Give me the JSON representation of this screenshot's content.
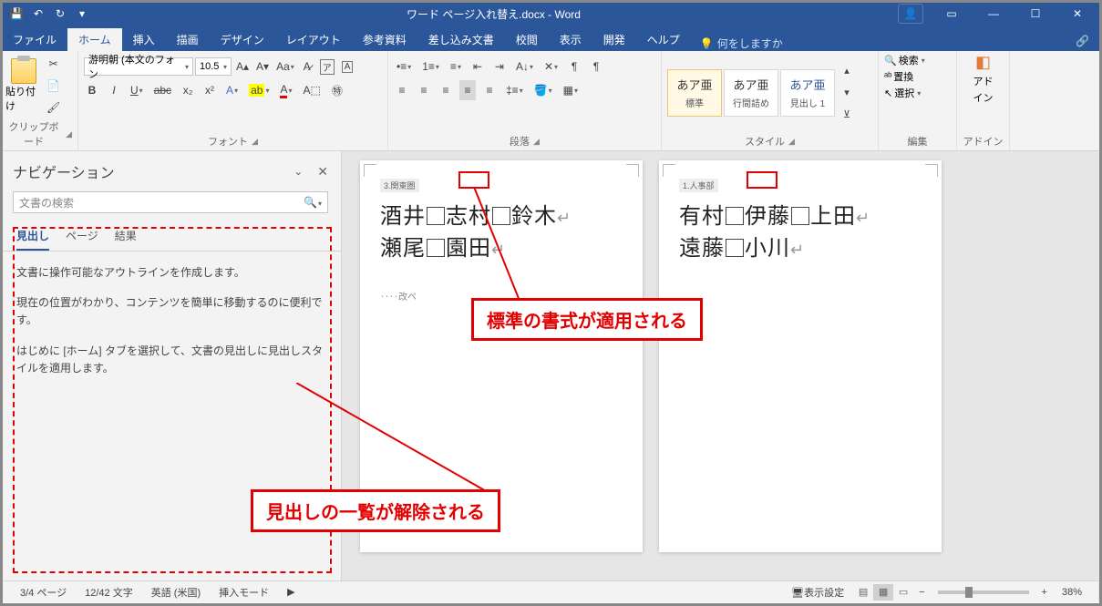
{
  "titlebar": {
    "title": "ワード ページ入れ替え.docx  -  Word"
  },
  "tabs": {
    "file": "ファイル",
    "home": "ホーム",
    "insert": "挿入",
    "draw": "描画",
    "design": "デザイン",
    "layout": "レイアウト",
    "references": "参考資料",
    "mailings": "差し込み文書",
    "review": "校閲",
    "view": "表示",
    "developer": "開発",
    "help": "ヘルプ",
    "tellme": "何をしますか",
    "share": "🔗"
  },
  "ribbon": {
    "clipboard": {
      "paste": "貼り付け",
      "label": "クリップボード"
    },
    "font": {
      "name": "游明朝 (本文のフォン",
      "size": "10.5",
      "label": "フォント"
    },
    "paragraph": {
      "label": "段落"
    },
    "styles": {
      "label": "スタイル",
      "sample": "あア亜",
      "normal": "標準",
      "nospacing": "行間詰め",
      "heading1": "見出し 1"
    },
    "editing": {
      "find": "検索",
      "replace": "置換",
      "select": "選択",
      "label": "編集"
    },
    "addins": {
      "label1": "アド",
      "label2": "イン",
      "group": "アドイン"
    }
  },
  "nav": {
    "title": "ナビゲーション",
    "search_placeholder": "文書の検索",
    "tab_headings": "見出し",
    "tab_pages": "ページ",
    "tab_results": "結果",
    "p1": "文書に操作可能なアウトラインを作成します。",
    "p2": "現在の位置がわかり、コンテンツを簡単に移動するのに便利です。",
    "p3": "はじめに [ホーム] タブを選択して、文書の見出しに見出しスタイルを適用します。"
  },
  "doc": {
    "page1": {
      "tag": "3.関東圏",
      "l1a": "酒井",
      "l1b": "志村",
      "l1c": "鈴木",
      "l2a": "瀬尾",
      "l2b": "園田",
      "break": "改ペ"
    },
    "page2": {
      "tag": "1.人事部",
      "l1a": "有村",
      "l1b": "伊藤",
      "l1c": "上田",
      "l2a": "遠藤",
      "l2b": "小川"
    }
  },
  "annot": {
    "a1": "標準の書式が適用される",
    "a2": "見出しの一覧が解除される"
  },
  "status": {
    "page": "3/4 ページ",
    "words": "12/42 文字",
    "lang": "英語 (米国)",
    "insert": "挿入モード",
    "display": "表示設定",
    "zoom": "38%"
  }
}
